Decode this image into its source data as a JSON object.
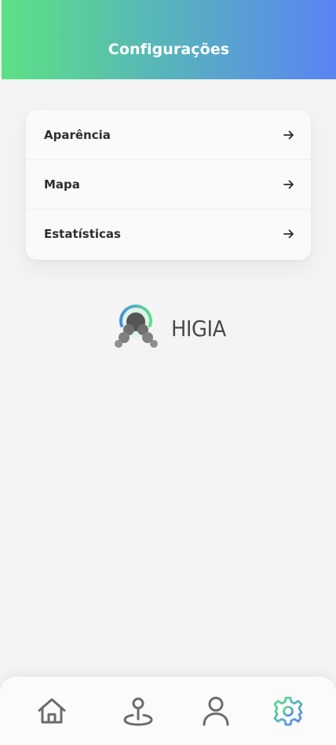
{
  "header": {
    "title": "Configurações"
  },
  "menu": {
    "items": [
      {
        "label": "Aparência",
        "icon": "arrow-right-icon"
      },
      {
        "label": "Mapa",
        "icon": "arrow-right-icon"
      },
      {
        "label": "Estatísticas",
        "icon": "arrow-right-icon"
      }
    ]
  },
  "brand": {
    "name": "HIGIA"
  },
  "nav": {
    "items": [
      {
        "icon": "home-icon",
        "active": false
      },
      {
        "icon": "map-pin-icon",
        "active": false
      },
      {
        "icon": "user-icon",
        "active": false
      },
      {
        "icon": "gear-icon",
        "active": true
      }
    ]
  },
  "colors": {
    "header_gradient_start": "#5ce184",
    "header_gradient_end": "#5a84f3",
    "icon_inactive": "#666666",
    "text_primary": "#2f2f2f"
  }
}
